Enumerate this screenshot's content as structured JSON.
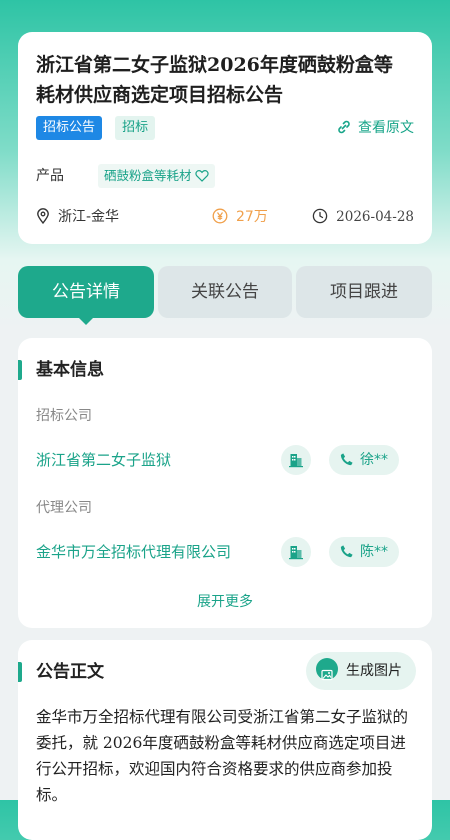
{
  "header": {
    "title": "浙江省第二女子监狱2026年度硒鼓粉盒等耗材供应商选定项目招标公告",
    "tag_type": "招标公告",
    "tag_stage": "招标",
    "view_original": "查看原文",
    "product_label": "产品",
    "product_value": "硒鼓粉盒等耗材",
    "location": "浙江-金华",
    "amount": "27万",
    "date": "2026-04-28",
    "colors": {
      "accent": "#1ea98c",
      "tag_blue": "#1e88e5",
      "amount": "#f0a04b"
    }
  },
  "tabs": [
    {
      "label": "公告详情",
      "active": true
    },
    {
      "label": "关联公告",
      "active": false
    },
    {
      "label": "项目跟进",
      "active": false
    }
  ],
  "basic_info": {
    "title": "基本信息",
    "tenderer_label": "招标公司",
    "tenderer_name": "浙江省第二女子监狱",
    "tenderer_contact": "徐**",
    "agent_label": "代理公司",
    "agent_name": "金华市万全招标代理有限公司",
    "agent_contact": "陈**",
    "expand_more": "展开更多"
  },
  "announcement": {
    "title": "公告正文",
    "generate_image": "生成图片",
    "body": "金华市万全招标代理有限公司受浙江省第二女子监狱的委托，就 2026年度硒鼓粉盒等耗材供应商选定项目进行公开招标，欢迎国内符合资格要求的供应商参加投标。"
  },
  "icons": [
    "link-icon",
    "heart-icon",
    "location-pin-icon",
    "yen-coin-icon",
    "clock-icon",
    "building-icon",
    "phone-icon",
    "image-icon"
  ]
}
